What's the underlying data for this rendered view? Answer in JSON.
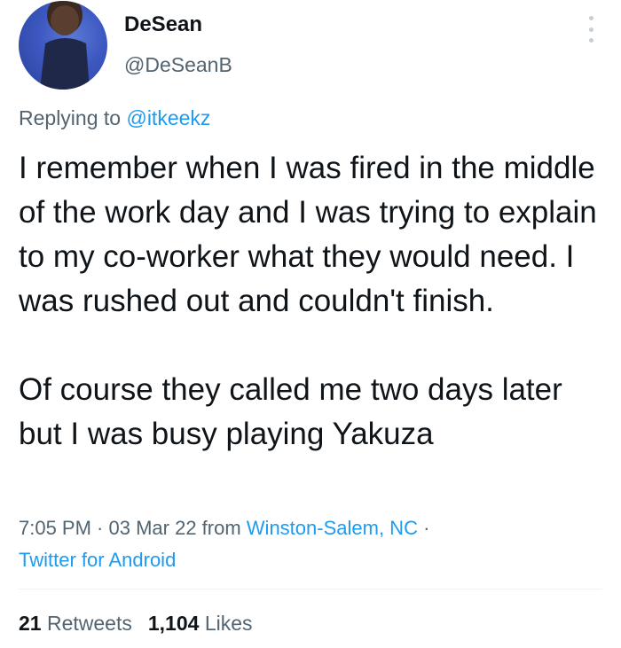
{
  "author": {
    "name": "DeSean",
    "handle": "@DeSeanB"
  },
  "reply": {
    "prefix": "Replying to ",
    "mention": "@itkeekz"
  },
  "tweet": {
    "paragraph1": "I remember when I was fired in the middle of the work day and I was trying to explain to my co-worker what they would need. I was rushed out and couldn't finish.",
    "paragraph2": "Of course they called me two days later but I was busy playing Yakuza"
  },
  "meta": {
    "time": "7:05 PM",
    "sep1": " · ",
    "date": "03 Mar 22",
    "from_label": " from ",
    "location": "Winston-Salem, NC",
    "sep2": " ·",
    "source": "Twitter for Android"
  },
  "stats": {
    "retweets_count": "21",
    "retweets_label": "Retweets",
    "likes_count": "1,104",
    "likes_label": "Likes"
  },
  "colors": {
    "link": "#1d9bf0",
    "secondary_text": "#536471",
    "primary_text": "#0f1419"
  },
  "icons": {
    "more": "more-vertical-icon"
  }
}
